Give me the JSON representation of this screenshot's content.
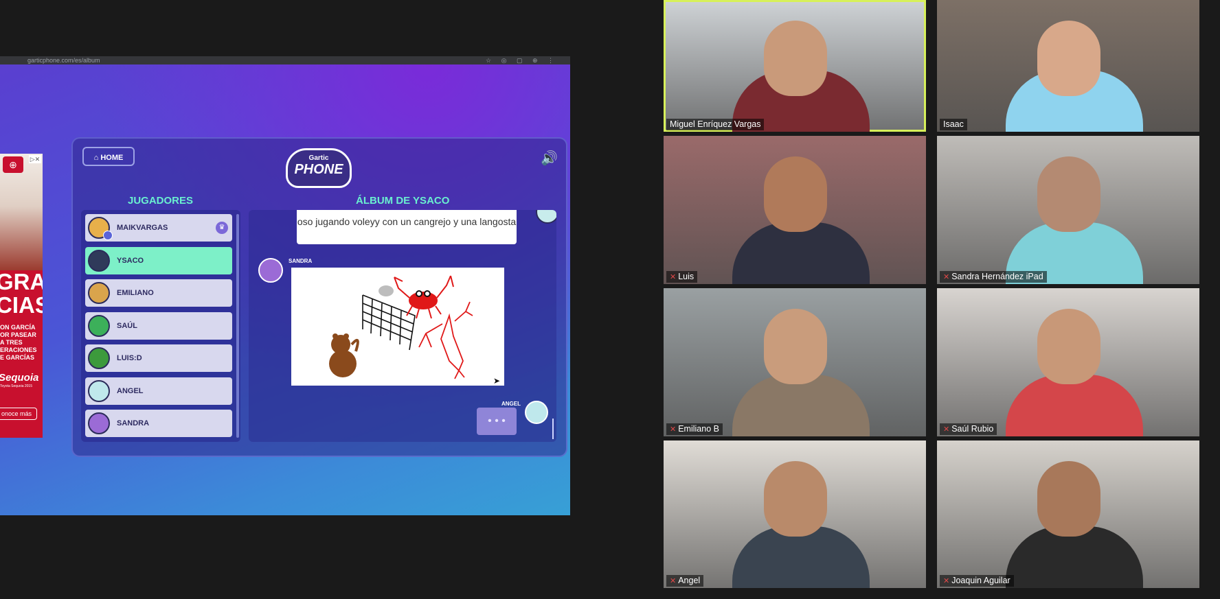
{
  "browser": {
    "url": "garticphone.com/es/album",
    "tools": "☆ ◎ ▢ ⊕ ⋮"
  },
  "ad": {
    "logo": "⊕",
    "close": "▷✕",
    "headline": "GRA\nCIAS",
    "body": "ON GARCÍA\nOR PASEAR\nA TRES\nERACIONES\nE GARCÍAS",
    "brand": "Sequoia",
    "fine_print": "Toyota Sequoia 2015",
    "cta": "onoce más"
  },
  "game": {
    "home_label": "HOME",
    "home_icon": "house-icon",
    "logo_top": "Gartic",
    "logo_bottom": "PHONE",
    "players_title": "JUGADORES",
    "album_title": "ÁLBUM DE YSACO",
    "players": [
      {
        "name": "MAIKVARGAS",
        "avatar_color": "#e8b04a",
        "host": true,
        "active": false
      },
      {
        "name": "YSACO",
        "avatar_color": "#2f3a5a",
        "host": false,
        "active": true
      },
      {
        "name": "EMILIANO",
        "avatar_color": "#d9a44c",
        "host": false,
        "active": false
      },
      {
        "name": "SAÚL",
        "avatar_color": "#3cb05a",
        "host": false,
        "active": false
      },
      {
        "name": "LUIS:D",
        "avatar_color": "#3c9a3c",
        "host": false,
        "active": false
      },
      {
        "name": "ANGEL",
        "avatar_color": "#bfe8ec",
        "host": false,
        "active": false
      },
      {
        "name": "SANDRA",
        "avatar_color": "#9b6bd6",
        "host": false,
        "active": false
      }
    ],
    "prompt_text": "oso jugando voleyy con un cangrejo y una langosta",
    "drawing_author": "SANDRA",
    "next_author": "ANGEL",
    "typing_indicator": "• • •"
  },
  "participants": [
    {
      "name": "Miguel Enríquez Vargas",
      "muted": false,
      "speaking": true,
      "bg": "#cfd3d6",
      "shirt": "#7a2a30",
      "skin": "#c99a7a"
    },
    {
      "name": "Isaac",
      "muted": false,
      "speaking": false,
      "bg": "#7d7066",
      "shirt": "#8fd3ee",
      "skin": "#d8a88a"
    },
    {
      "name": "Luis",
      "muted": true,
      "speaking": false,
      "bg": "#9a6a6a",
      "shirt": "#2e3040",
      "skin": "#b07a5a"
    },
    {
      "name": "Sandra Hernández iPad",
      "muted": true,
      "speaking": false,
      "bg": "#bfbcb8",
      "shirt": "#7fd0d8",
      "skin": "#b48a72"
    },
    {
      "name": "Emiliano B",
      "muted": true,
      "speaking": false,
      "bg": "#9aa0a2",
      "shirt": "#8a7866",
      "skin": "#c99c7c"
    },
    {
      "name": "Saúl Rubio",
      "muted": true,
      "speaking": false,
      "bg": "#d8d4d0",
      "shirt": "#d4464a",
      "skin": "#c89878"
    },
    {
      "name": "Angel",
      "muted": true,
      "speaking": false,
      "bg": "#e0dcd6",
      "shirt": "#3a4450",
      "skin": "#b98a6a"
    },
    {
      "name": "Joaquin Aguilar",
      "muted": true,
      "speaking": false,
      "bg": "#d6d2cc",
      "shirt": "#2a2a2a",
      "skin": "#a8785a"
    }
  ]
}
